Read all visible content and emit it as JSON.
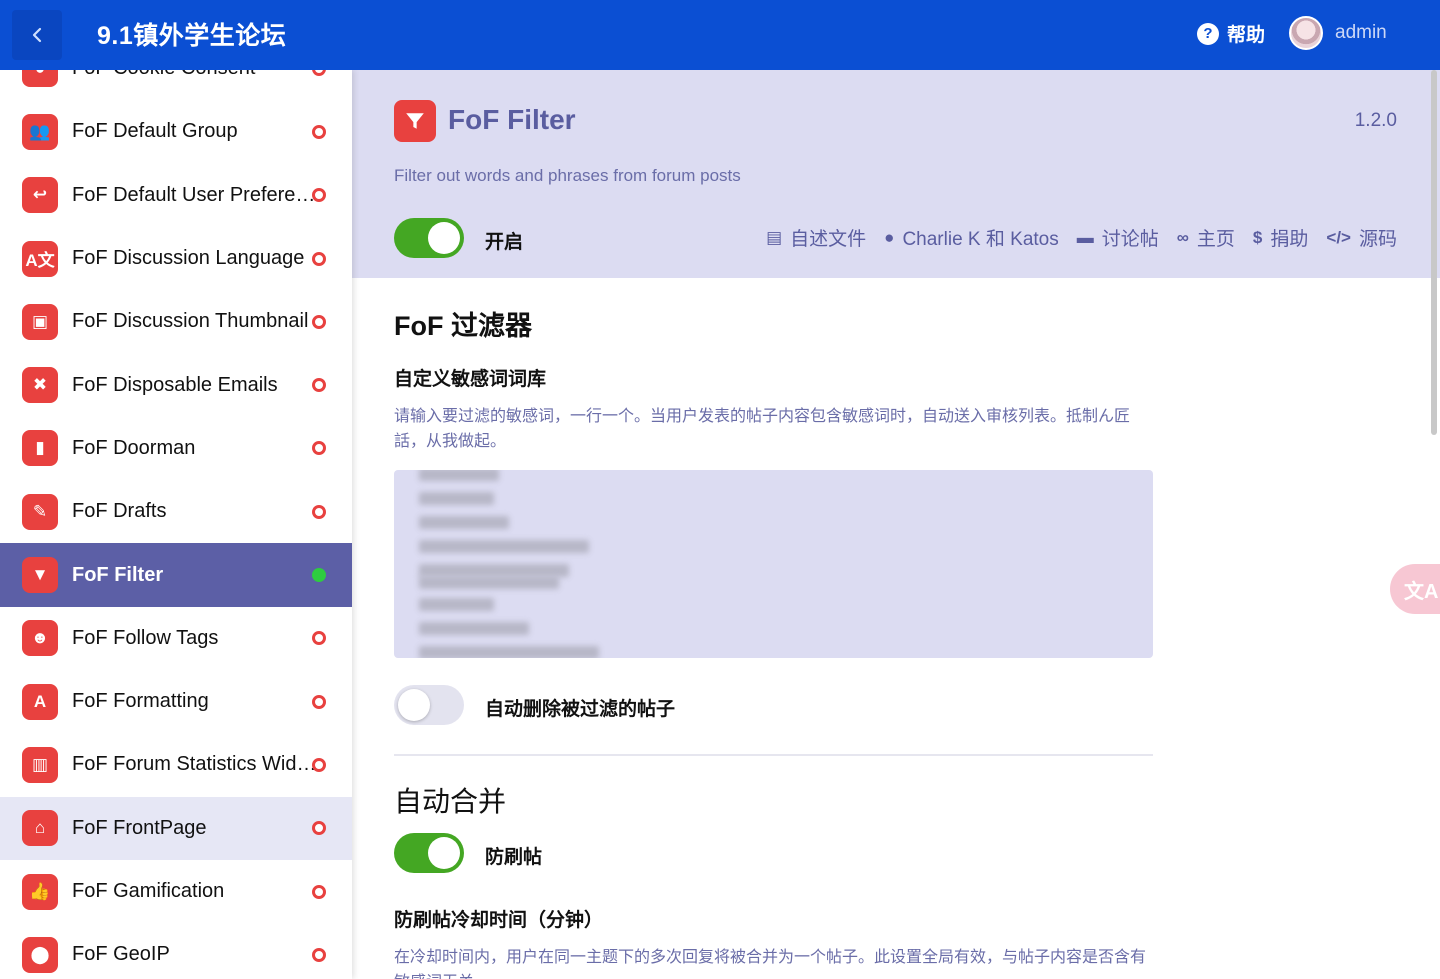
{
  "header": {
    "site_title": "9.1镇外学生论坛",
    "help_label": "帮助",
    "username": "admin"
  },
  "sidebar": {
    "items": [
      {
        "label": "FoF Cookie Consent",
        "icon": "cookie-icon",
        "glyph": "●",
        "state": "normal",
        "enabled": false
      },
      {
        "label": "FoF Default Group",
        "icon": "users-icon",
        "glyph": "👥",
        "state": "normal",
        "enabled": false
      },
      {
        "label": "FoF Default User Preferences",
        "icon": "reply-icon",
        "glyph": "↩",
        "state": "normal",
        "enabled": false
      },
      {
        "label": "FoF Discussion Language",
        "icon": "language-icon",
        "glyph": "A文",
        "state": "normal",
        "enabled": false
      },
      {
        "label": "FoF Discussion Thumbnail",
        "icon": "image-icon",
        "glyph": "▣",
        "state": "normal",
        "enabled": false
      },
      {
        "label": "FoF Disposable Emails",
        "icon": "user-x-icon",
        "glyph": "✖",
        "state": "normal",
        "enabled": false
      },
      {
        "label": "FoF Doorman",
        "icon": "door-icon",
        "glyph": "▮",
        "state": "normal",
        "enabled": false
      },
      {
        "label": "FoF Drafts",
        "icon": "edit-icon",
        "glyph": "✎",
        "state": "normal",
        "enabled": false
      },
      {
        "label": "FoF Filter",
        "icon": "filter-icon",
        "glyph": "▼",
        "state": "active",
        "enabled": true
      },
      {
        "label": "FoF Follow Tags",
        "icon": "user-tag-icon",
        "glyph": "☻",
        "state": "normal",
        "enabled": false
      },
      {
        "label": "FoF Formatting",
        "icon": "font-icon",
        "glyph": "A",
        "state": "normal",
        "enabled": false
      },
      {
        "label": "FoF Forum Statistics Widget",
        "icon": "chart-icon",
        "glyph": "▥",
        "state": "normal",
        "enabled": false
      },
      {
        "label": "FoF FrontPage",
        "icon": "home-icon",
        "glyph": "⌂",
        "state": "hover",
        "enabled": false
      },
      {
        "label": "FoF Gamification",
        "icon": "thumbs-up-icon",
        "glyph": "👍",
        "state": "normal",
        "enabled": false
      },
      {
        "label": "FoF GeoIP",
        "icon": "map-pin-icon",
        "glyph": "⬤",
        "state": "normal",
        "enabled": false
      }
    ]
  },
  "extension": {
    "title": "FoF Filter",
    "version": "1.2.0",
    "description": "Filter out words and phrases from forum posts",
    "enabled_label": "开启",
    "enabled": true,
    "links": [
      {
        "label": "自述文件",
        "icon": "book-icon",
        "glyph": "▤"
      },
      {
        "label": "Charlie K 和 Katos",
        "icon": "person-icon",
        "glyph": "●"
      },
      {
        "label": "讨论帖",
        "icon": "comment-icon",
        "glyph": "▬"
      },
      {
        "label": "主页",
        "icon": "link-icon",
        "glyph": "∞"
      },
      {
        "label": "捐助",
        "icon": "donate-icon",
        "glyph": "$"
      },
      {
        "label": "源码",
        "icon": "code-icon",
        "glyph": "</>"
      }
    ]
  },
  "settings": {
    "section_title": "FoF 过滤器",
    "word_list_label": "自定义敏感词词库",
    "word_list_help": "请输入要过滤的敏感词，一行一个。当用户发表的帖子内容包含敏感词时，自动送入审核列表。抵制ん匠話，从我做起。",
    "auto_delete_label": "自动删除被过滤的帖子",
    "auto_delete_enabled": false,
    "merge_section_title": "自动合并",
    "anti_spam_label": "防刷帖",
    "anti_spam_enabled": true,
    "cooldown_label": "防刷帖冷却时间（分钟）",
    "cooldown_help": "在冷却时间内，用户在同一主题下的多次回复将被合并为一个帖子。此设置全局有效，与帖子内容是否含有敏感词无关。"
  },
  "floating": {
    "translate_glyph": "文A"
  },
  "colors": {
    "header_bg": "#0b4fd3",
    "accent_red": "#e8413f",
    "active_item_bg": "#5c5fa6",
    "extension_header_bg": "#dcdcf2",
    "toggle_on": "#44a723",
    "status_enabled": "#2ecc40"
  }
}
